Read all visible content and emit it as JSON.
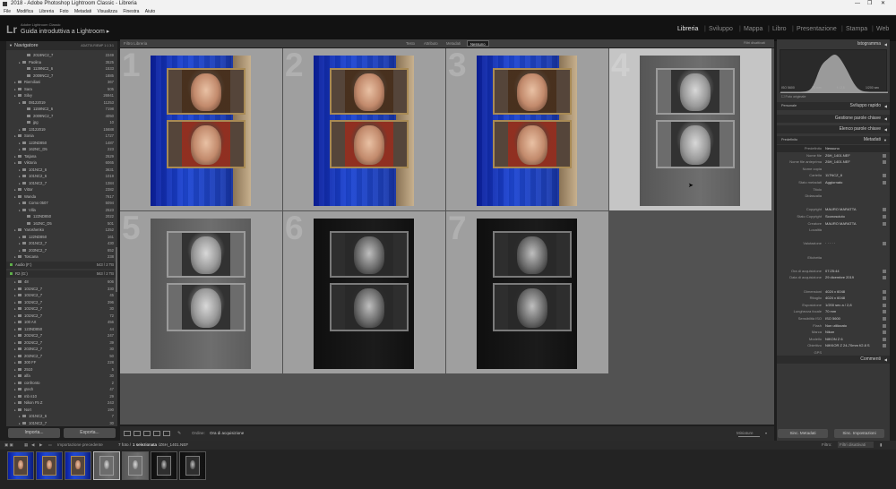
{
  "window": {
    "title": "2018 - Adobe Photoshop Lightroom Classic - Libreria",
    "controls": [
      "—",
      "❐",
      "✕"
    ]
  },
  "menu": [
    "File",
    "Modifica",
    "Libreria",
    "Foto",
    "Metadati",
    "Visualizza",
    "Finestra",
    "Aiuto"
  ],
  "identity": {
    "logo": "Lr",
    "line1": "Adobe Lightroom Classic",
    "line2": "Guida introduttiva a Lightroom",
    "arrow": "▸"
  },
  "modules": [
    {
      "label": "Libreria",
      "active": true
    },
    {
      "label": "Sviluppo",
      "active": false
    },
    {
      "label": "Mappa",
      "active": false
    },
    {
      "label": "Libro",
      "active": false
    },
    {
      "label": "Presentazione",
      "active": false
    },
    {
      "label": "Stampa",
      "active": false
    },
    {
      "label": "Web",
      "active": false
    }
  ],
  "left_panel": {
    "navigator": {
      "title": "Navigatore",
      "zoom": "ADATTA  RIEMP  1:1  3:1"
    },
    "folders": [
      {
        "indent": 3,
        "label": "2019NC2_7",
        "count": "2249"
      },
      {
        "indent": 2,
        "label": "Paolina",
        "count": "3525"
      },
      {
        "indent": 3,
        "label": "1139NC2_6",
        "count": "1533"
      },
      {
        "indent": 3,
        "label": "2009NC2_7",
        "count": "1885"
      },
      {
        "indent": 1,
        "label": "Riemiliani",
        "count": "367"
      },
      {
        "indent": 1,
        "label": "Sara",
        "count": "505"
      },
      {
        "indent": 1,
        "label": "Silvy",
        "count": "26941"
      },
      {
        "indent": 2,
        "label": "08122019",
        "count": "11253"
      },
      {
        "indent": 3,
        "label": "1159NC2_6",
        "count": "7198"
      },
      {
        "indent": 3,
        "label": "2009NC2_7",
        "count": "4050"
      },
      {
        "indent": 3,
        "label": "jpg",
        "count": "10"
      },
      {
        "indent": 2,
        "label": "13122019",
        "count": "15688"
      },
      {
        "indent": 1,
        "label": "Sonia",
        "count": "1727"
      },
      {
        "indent": 2,
        "label": "123ND850",
        "count": "1487"
      },
      {
        "indent": 2,
        "label": "162NC_D5",
        "count": "223"
      },
      {
        "indent": 1,
        "label": "Tatjana",
        "count": "2529"
      },
      {
        "indent": 1,
        "label": "Viktoria",
        "count": "6065"
      },
      {
        "indent": 2,
        "label": "101NC2_6",
        "count": "3631"
      },
      {
        "indent": 2,
        "label": "101NC2_6",
        "count": "1019"
      },
      {
        "indent": 2,
        "label": "101NC2_7",
        "count": "1384"
      },
      {
        "indent": 1,
        "label": "Vittor",
        "count": "2382"
      },
      {
        "indent": 1,
        "label": "Wanda",
        "count": "7617"
      },
      {
        "indent": 2,
        "label": "Como 0507",
        "count": "5094"
      },
      {
        "indent": 2,
        "label": "Villa",
        "count": "2523"
      },
      {
        "indent": 3,
        "label": "122ND850",
        "count": "2022"
      },
      {
        "indent": 3,
        "label": "162NC_D5",
        "count": "501"
      },
      {
        "indent": 1,
        "label": "Yaroshenko",
        "count": "1252"
      },
      {
        "indent": 2,
        "label": "122ND850",
        "count": "161"
      },
      {
        "indent": 2,
        "label": "201NC2_7",
        "count": "430"
      },
      {
        "indent": 2,
        "label": "203NC2_7",
        "count": "652"
      },
      {
        "indent": 1,
        "label": "Toscana",
        "count": "238"
      }
    ],
    "volumes": [
      {
        "label": "Audio (F:)",
        "count": "543 / 2 TB"
      },
      {
        "label": "R2 (G:)",
        "count": "563 / 2 TB"
      }
    ],
    "folders2": [
      {
        "indent": 1,
        "label": "48",
        "count": "606"
      },
      {
        "indent": 1,
        "label": "101NC2_7",
        "count": "330"
      },
      {
        "indent": 1,
        "label": "101NC2_7",
        "count": "45"
      },
      {
        "indent": 1,
        "label": "101NC2_7",
        "count": "396"
      },
      {
        "indent": 1,
        "label": "101NC2_7",
        "count": "30"
      },
      {
        "indent": 1,
        "label": "101NC2_7",
        "count": "72"
      },
      {
        "indent": 1,
        "label": "100 Art",
        "count": "456"
      },
      {
        "indent": 1,
        "label": "123ND850",
        "count": "44"
      },
      {
        "indent": 1,
        "label": "201NC2_7",
        "count": "247"
      },
      {
        "indent": 1,
        "label": "201NC2_7",
        "count": "39"
      },
      {
        "indent": 1,
        "label": "203NC2_7",
        "count": "30"
      },
      {
        "indent": 1,
        "label": "202NC2_7",
        "count": "50"
      },
      {
        "indent": 1,
        "label": "300 FF",
        "count": "228"
      },
      {
        "indent": 1,
        "label": "2510",
        "count": "5"
      },
      {
        "indent": 1,
        "label": "alfa",
        "count": "30"
      },
      {
        "indent": 1,
        "label": "confronto",
        "count": "2"
      },
      {
        "indent": 1,
        "label": "gtech",
        "count": "47"
      },
      {
        "indent": 1,
        "label": "mb n10",
        "count": "29"
      },
      {
        "indent": 1,
        "label": "Nikon F5 Z",
        "count": "243"
      },
      {
        "indent": 1,
        "label": "Nort",
        "count": "190"
      },
      {
        "indent": 2,
        "label": "101NC2_6",
        "count": "7"
      },
      {
        "indent": 2,
        "label": "101NC2_7",
        "count": "30"
      }
    ],
    "import_label": "Importa...",
    "export_label": "Esporta..."
  },
  "center": {
    "topbar_label": "Filtro Libreria",
    "filter_tabs": [
      "Testo",
      "Attributo",
      "Metadati",
      "Nessuno"
    ],
    "active_filter": "Nessuno",
    "filter_right": "Filtri disattivati",
    "grid": [
      {
        "num": "1",
        "tone": "blue",
        "selected": false
      },
      {
        "num": "2",
        "tone": "blue",
        "selected": false
      },
      {
        "num": "3",
        "tone": "blue",
        "selected": false
      },
      {
        "num": "4",
        "tone": "gray1",
        "selected": true
      },
      {
        "num": "5",
        "tone": "gray1",
        "selected": false
      },
      {
        "num": "6",
        "tone": "dark",
        "selected": false
      },
      {
        "num": "7",
        "tone": "dark",
        "selected": false
      }
    ],
    "toolbar": {
      "sort_prefix": "Ordine:",
      "sort_value": "Ora di acquisizione",
      "thumbs_label": "Miniature"
    }
  },
  "right_panel": {
    "histogram_title": "Istogramma",
    "histogram_info": [
      "ISO 5600",
      "70 mm",
      "f / 2,8",
      "1/200 sec"
    ],
    "orig_photo_label": "Foto originale",
    "quick_develop": {
      "title": "Sviluppo rapido",
      "preset": "Personale"
    },
    "keywording_title": "Gestione parole chiave",
    "keyword_list_title": "Elenco parole chiave",
    "metadata_title": "Metadati",
    "metadata_preset": "Predefinito",
    "metadata_rows": [
      {
        "label": "Predefinito",
        "value": "Nessuno"
      },
      {
        "label": "Nome file",
        "value": "Z6H_1401.NEF"
      },
      {
        "label": "Nome file anteprima",
        "value": "Z6H_1401.NEF"
      },
      {
        "label": "Nome copia",
        "value": ""
      },
      {
        "label": "Cartella",
        "value": "117NCZ_6"
      },
      {
        "label": "Stato metadati",
        "value": "Aggiornato"
      },
      {
        "label": "Titolo",
        "value": ""
      },
      {
        "label": "Didascalia",
        "value": ""
      },
      {
        "label": "",
        "value": ""
      },
      {
        "label": "Copyright",
        "value": "MAURO MARATTA"
      },
      {
        "label": "Stato Copyright",
        "value": "Sconosciuto"
      },
      {
        "label": "Creatore",
        "value": "MAURO MARATTA"
      },
      {
        "label": "Località",
        "value": ""
      },
      {
        "label": "",
        "value": ""
      },
      {
        "label": "Valutazione",
        "value": "· · · · ·"
      },
      {
        "label": "",
        "value": ""
      },
      {
        "label": "Etichetta",
        "value": ""
      },
      {
        "label": "",
        "value": ""
      },
      {
        "label": "Ora di acquisizione",
        "value": "07:25:44"
      },
      {
        "label": "Data di acquisizione",
        "value": "29 dicembre 2019"
      },
      {
        "label": "",
        "value": ""
      },
      {
        "label": "Dimensioni",
        "value": "4024 x 6048"
      },
      {
        "label": "Ritaglio",
        "value": "4024 x 6048"
      },
      {
        "label": "Esposizione",
        "value": "1/200 sec a / 2,8"
      },
      {
        "label": "Lunghezza focale",
        "value": "70 mm"
      },
      {
        "label": "Sensibilità ISO",
        "value": "ISO 5600"
      },
      {
        "label": "Flash",
        "value": "Non utilizzato"
      },
      {
        "label": "Marca",
        "value": "Nikon"
      },
      {
        "label": "Modello",
        "value": "NIKON Z 6"
      },
      {
        "label": "Obiettivo",
        "value": "NIKKOR Z 24-70mm f/2.8 S"
      },
      {
        "label": "GPS",
        "value": ""
      }
    ],
    "comments_title": "Commenti",
    "sync_metadata": "Sinc. Metadati",
    "sync_settings": "Sinc. Impostazioni"
  },
  "filmstrip_bar": {
    "page": "1 2",
    "source": "Importazione precedente",
    "info_count": "7 foto /",
    "info_selected": "1 selezionata",
    "info_file": "/Z6H_1401.NEF",
    "filter_label": "Filtro:",
    "filter_value": "Filtri disattivati"
  },
  "filmstrip": [
    "blue",
    "blue",
    "blue",
    "gray1",
    "gray1",
    "dark",
    "dark"
  ]
}
